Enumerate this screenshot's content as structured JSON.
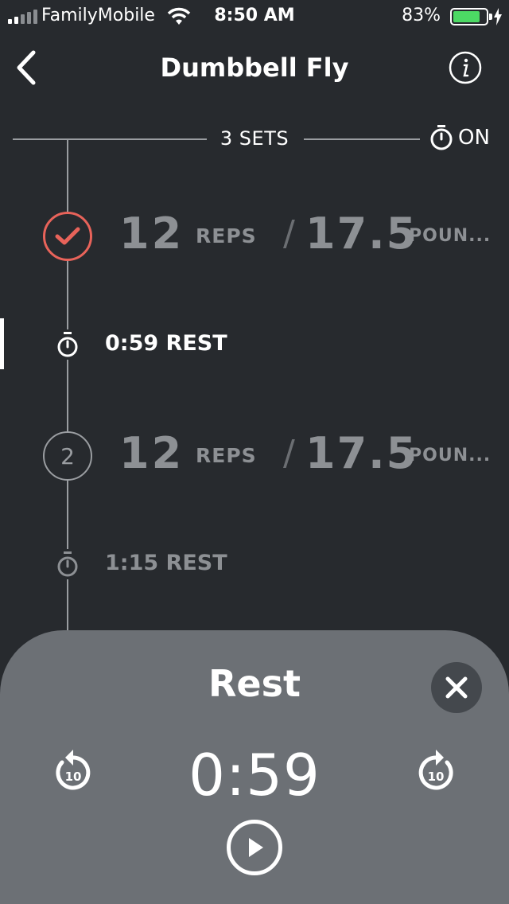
{
  "status_bar": {
    "carrier": "FamilyMobile",
    "time": "8:50 AM",
    "battery_percent": "83%",
    "battery_level": 0.83,
    "signal_bars": 2
  },
  "nav": {
    "title": "Dumbbell Fly",
    "back_icon": "chevron-left-icon",
    "info_icon": "info-icon"
  },
  "sets_header": {
    "label": "3 SETS",
    "timer_label": "ON",
    "timer_icon": "stopwatch-icon"
  },
  "sets": [
    {
      "marker": "",
      "status": "done",
      "reps": "12",
      "reps_unit": "REPS",
      "slash": "/",
      "weight": "17.5",
      "weight_unit": "POUN..."
    },
    {
      "marker": "2",
      "status": "pending",
      "reps": "12",
      "reps_unit": "REPS",
      "slash": "/",
      "weight": "17.5",
      "weight_unit": "POUN..."
    }
  ],
  "rests": [
    {
      "label": "0:59 REST",
      "active": true
    },
    {
      "label": "1:15 REST",
      "active": false
    }
  ],
  "rest_panel": {
    "title": "Rest",
    "countdown": "0:59",
    "rewind_label": "10",
    "forward_label": "10"
  },
  "colors": {
    "background": "#272a2e",
    "panel": "#6c7075",
    "accent_done": "#e8635a",
    "battery": "#4cd964"
  }
}
